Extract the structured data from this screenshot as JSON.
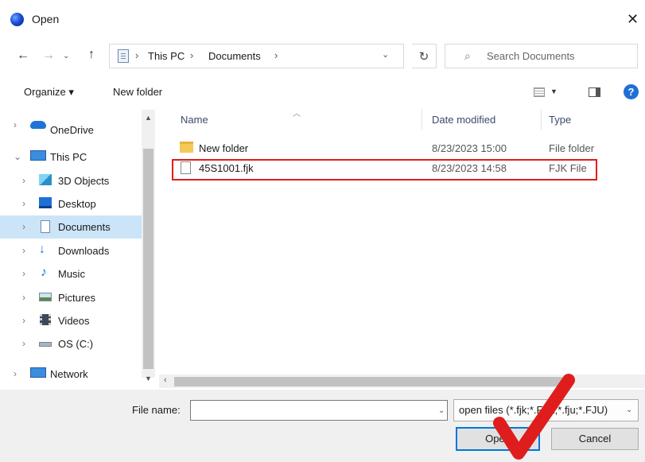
{
  "window": {
    "title": "Open",
    "close_glyph": "✕"
  },
  "nav": {
    "back_glyph": "←",
    "forward_glyph": "→",
    "recent_glyph": "⌄",
    "up_glyph": "↑",
    "breadcrumbs": [
      "This PC",
      "Documents"
    ],
    "separator": "›",
    "dropdown_glyph": "⌄",
    "refresh_glyph": "↻",
    "search_placeholder": "Search Documents",
    "search_glyph": "⌕"
  },
  "toolbar": {
    "organize_label": "Organize ▾",
    "new_folder_label": "New folder",
    "view_chevron": "▼",
    "help_label": "?"
  },
  "sidebar": {
    "items": [
      {
        "label": "OneDrive",
        "chev": "›",
        "icon": "cloud-icon"
      },
      {
        "label": "This PC",
        "chev": "⌄",
        "icon": "computer-icon"
      },
      {
        "label": "3D Objects",
        "chev": "›",
        "icon": "cube-icon"
      },
      {
        "label": "Desktop",
        "chev": "›",
        "icon": "desktop-icon"
      },
      {
        "label": "Documents",
        "chev": "›",
        "icon": "document-icon",
        "selected": true
      },
      {
        "label": "Downloads",
        "chev": "›",
        "icon": "download-icon"
      },
      {
        "label": "Music",
        "chev": "›",
        "icon": "music-icon"
      },
      {
        "label": "Pictures",
        "chev": "›",
        "icon": "pictures-icon"
      },
      {
        "label": "Videos",
        "chev": "›",
        "icon": "video-icon"
      },
      {
        "label": "OS (C:)",
        "chev": "›",
        "icon": "drive-icon"
      },
      {
        "label": "Network",
        "chev": "›",
        "icon": "network-icon"
      }
    ],
    "scroll_up": "▲",
    "scroll_down": "▼"
  },
  "list": {
    "columns": {
      "name": "Name",
      "date": "Date modified",
      "type": "Type"
    },
    "sort_glyph": "︿",
    "files": [
      {
        "name": "New folder",
        "date": "8/23/2023 15:00",
        "type": "File folder",
        "icon": "folder-icon"
      },
      {
        "name": "45S1001.fjk",
        "date": "8/23/2023 14:58",
        "type": "FJK File",
        "icon": "file-icon"
      }
    ],
    "hscroll_left": "‹"
  },
  "bottom": {
    "file_name_label": "File name:",
    "file_name_value": "",
    "dropdown_glyph": "⌄",
    "file_type_value": "open files (*.fjk;*.FJK;*.fju;*.FJU)",
    "open_label": "Open",
    "cancel_label": "Cancel"
  },
  "colors": {
    "accent": "#0078d7",
    "highlight": "#e01d1d",
    "selected": "#cce4f7"
  }
}
